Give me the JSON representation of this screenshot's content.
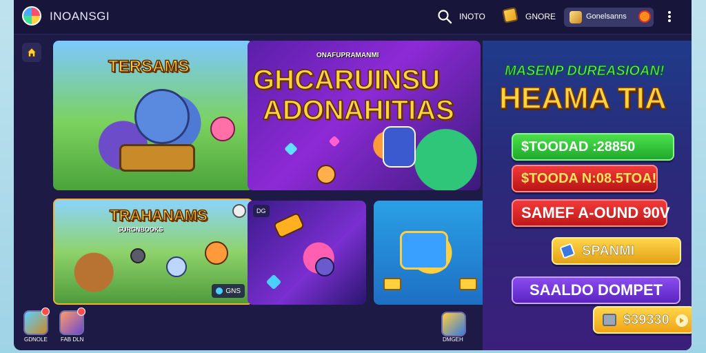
{
  "header": {
    "app_title": "INOANSGI",
    "search_text": "INOTO",
    "coins_text": "GNORE",
    "profile_text": "Gonelsanns"
  },
  "tiles": [
    {
      "title": "TERSAMS"
    },
    {
      "subtitle": "ONAFUPRAMANMI",
      "title_line1": "GHCARUINSU",
      "title_line2": "ADONAHITIAS"
    },
    {
      "title": "TRAHANAMS",
      "subtitle": "SURGNBOOKS",
      "tag": "GNS"
    },
    {
      "tag": "DG"
    },
    {}
  ],
  "promo": {
    "kicker": "MASENP DUREASIOAN!",
    "headline": "HEAMA TIA",
    "bar_green": "$TOODAD :28850",
    "bar_red1": "$TOODA N:08.5TOA!",
    "bar_red2": "SAMEF A-OUND 90V",
    "bar_gold": "SPANMI",
    "bar_purple": "SAALDO DOMPET",
    "balance": "$39330"
  },
  "bottom": {
    "app1_label": "GDNOLE",
    "app2_label": "FAB DLN",
    "app3_label": "DMGEH"
  },
  "colors": {
    "app_bg": "#1d1a45",
    "accent_gold": "#ffd23f",
    "accent_green": "#4be04b",
    "accent_red": "#f23a3a",
    "accent_purple": "#8a4cf0"
  }
}
